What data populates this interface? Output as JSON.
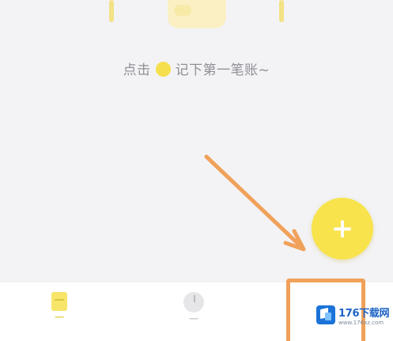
{
  "empty_state": {
    "hint_before": "点击",
    "hint_after": "记下第一笔账~",
    "dot_icon": "yellow-dot-icon"
  },
  "fab": {
    "symbol": "+",
    "color": "#f8e34d"
  },
  "annotation": {
    "arrow_color": "#f0a15a",
    "highlight_color": "#f0a15a"
  },
  "tabbar": {
    "tabs": [
      {
        "icon": "ledger-icon",
        "active": true
      },
      {
        "icon": "chart-icon",
        "active": false
      },
      {
        "icon": "profile-icon",
        "active": false
      }
    ]
  },
  "watermark": {
    "title": "176下载网",
    "url": "www.176xz.com",
    "brand_color": "#1d64c6"
  }
}
